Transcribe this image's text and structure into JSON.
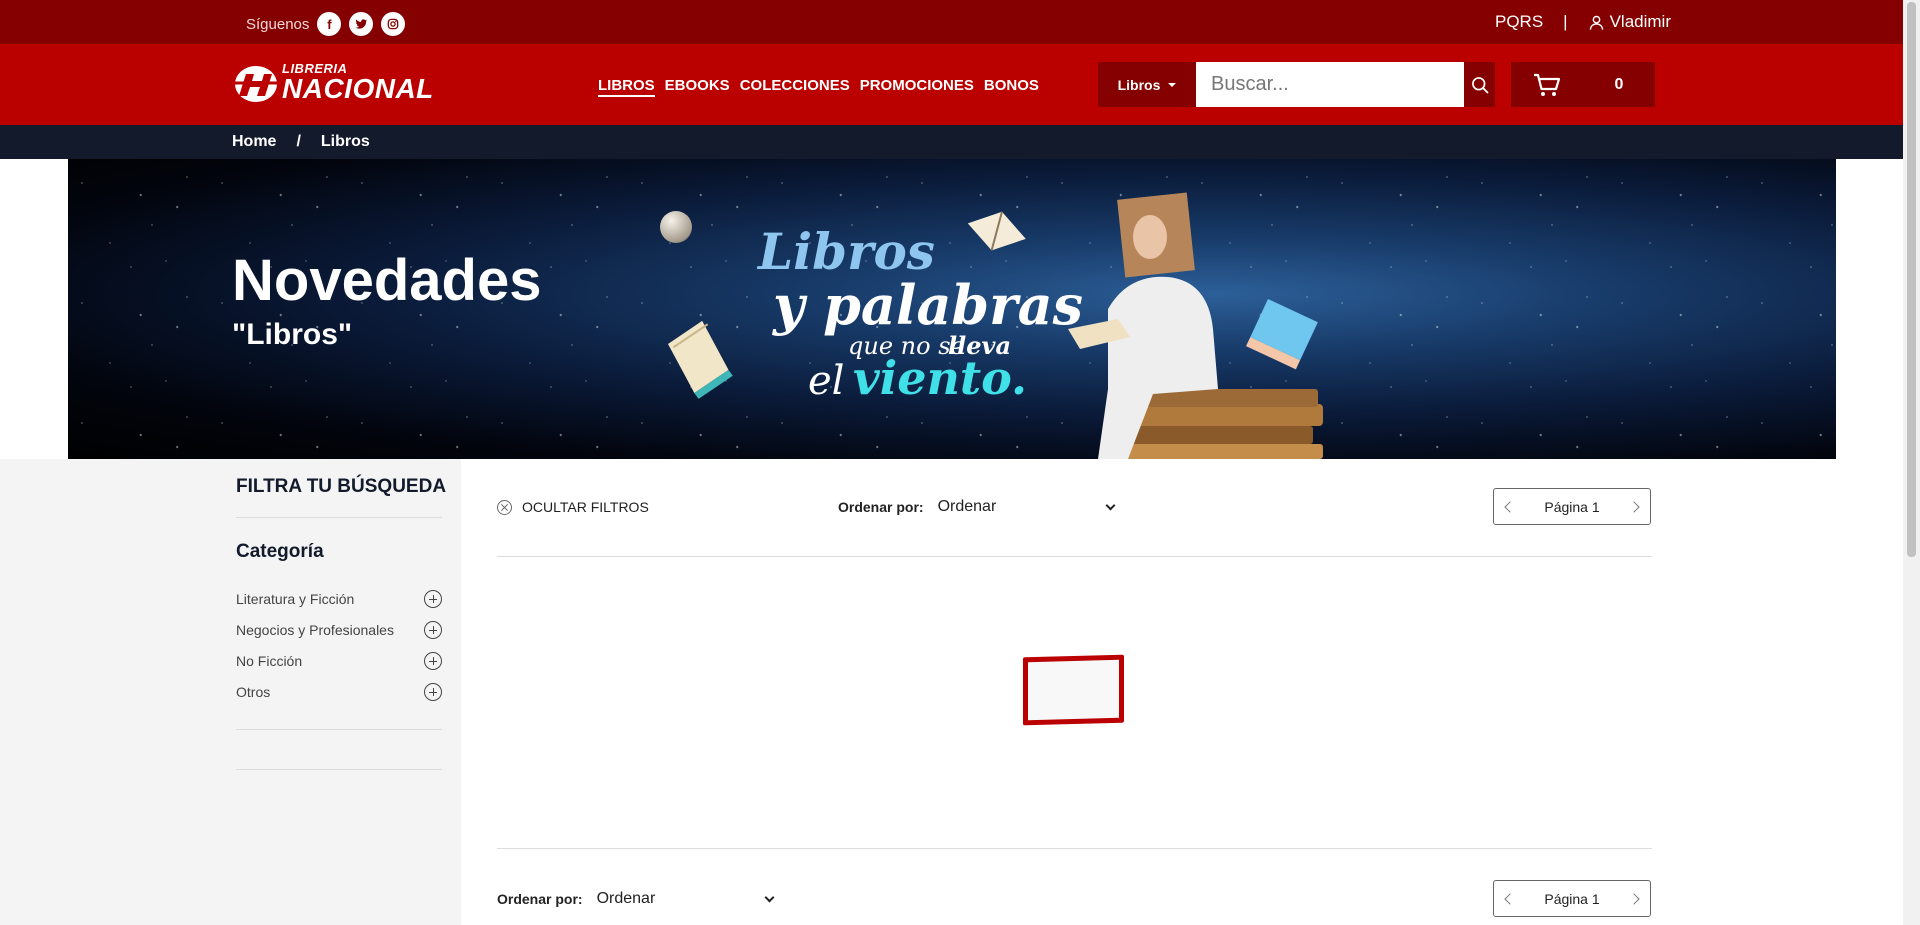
{
  "topbar": {
    "follow_label": "Síguenos",
    "social": [
      {
        "icon": "facebook-icon",
        "glyph": "f"
      },
      {
        "icon": "twitter-icon"
      },
      {
        "icon": "instagram-icon"
      }
    ],
    "pqrs": "PQRS",
    "separator": "|",
    "user": "Vladimir"
  },
  "header": {
    "logo_small": "LIBRERIA",
    "logo_big": "NACIONAL",
    "nav": [
      "LIBROS",
      "EBOOKS",
      "COLECCIONES",
      "PROMOCIONES",
      "BONOS"
    ],
    "active_nav": "LIBROS",
    "search_category": "Libros",
    "search_placeholder": "Buscar...",
    "cart_count": "0"
  },
  "breadcrumb": {
    "home": "Home",
    "sep": "/",
    "current": "Libros"
  },
  "banner": {
    "title": "Novedades",
    "subtitle": "\"Libros\"",
    "art_line1": "Libros",
    "art_line2": "y palabras",
    "art_line3a": "que no se",
    "art_line3b": "lleva",
    "art_line4a": "el",
    "art_line4b": "viento."
  },
  "filters": {
    "title": "FILTRA TU BÚSQUEDA",
    "category_title": "Categoría",
    "categories": [
      "Literatura y Ficción",
      "Negocios y Profesionales",
      "No Ficción",
      "Otros"
    ]
  },
  "toolbar": {
    "hide_filters": "OCULTAR FILTROS",
    "sort_label": "Ordenar por:",
    "sort_value": "Ordenar",
    "page_label": "Página 1"
  },
  "colors": {
    "brand_red": "#bb0000",
    "dark_red": "#850000",
    "navy": "#131a2b",
    "cyan_accent": "#3fe0e8"
  }
}
